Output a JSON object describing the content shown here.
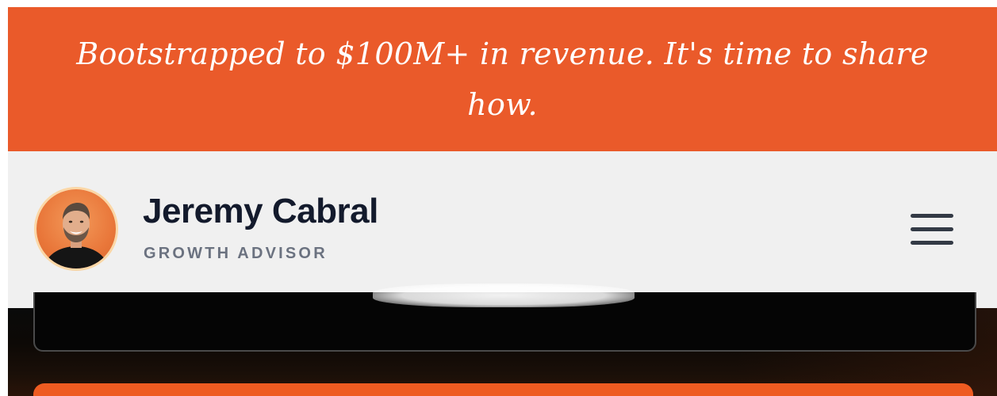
{
  "announcement": {
    "text": "Bootstrapped to $100M+ in revenue. It's time to share how."
  },
  "header": {
    "name": "Jeremy Cabral",
    "tagline": "GROWTH ADVISOR",
    "avatar_icon": "profile-photo",
    "menu_icon": "hamburger-menu-icon"
  },
  "colors": {
    "banner": "#ea5a2a",
    "header_bg": "#f0f0f0",
    "name_text": "#131a2c",
    "tagline_text": "#6b7280",
    "hero_bg": "#0a0a0a",
    "cta": "#ee5b21"
  }
}
